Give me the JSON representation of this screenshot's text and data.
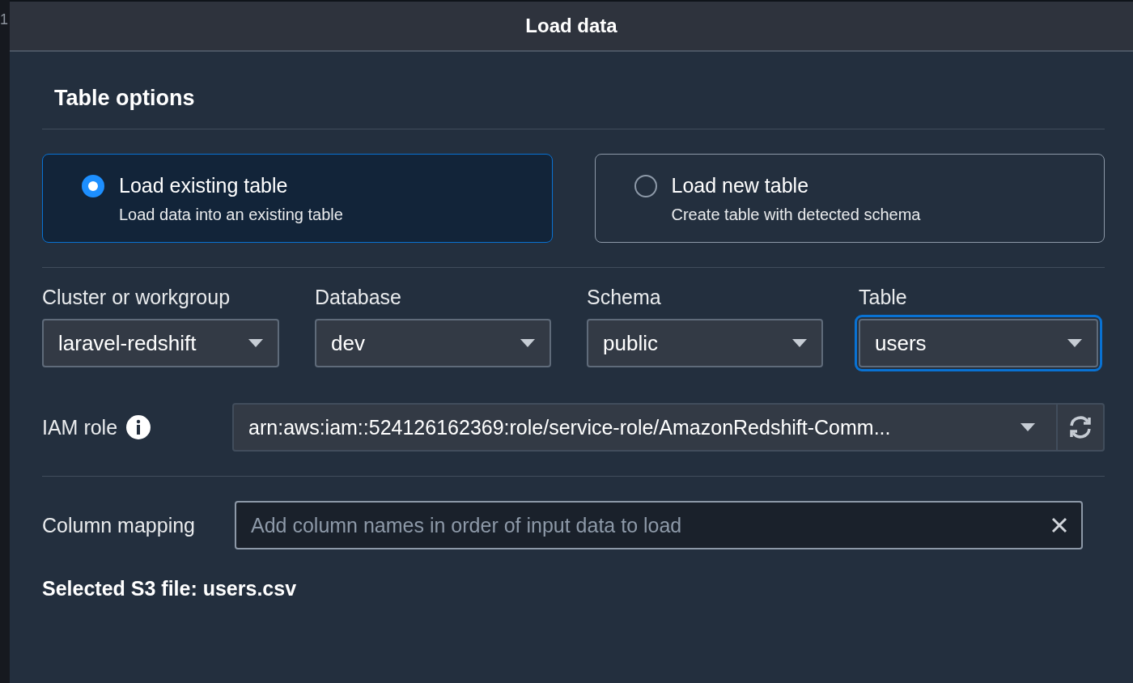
{
  "gutter": {
    "line_number": "1"
  },
  "dialog": {
    "title": "Load data"
  },
  "section": {
    "title": "Table options"
  },
  "load_options": [
    {
      "label": "Load existing table",
      "description": "Load data into an existing table",
      "selected": true
    },
    {
      "label": "Load new table",
      "description": "Create table with detected schema",
      "selected": false
    }
  ],
  "selects": [
    {
      "label": "Cluster or workgroup",
      "value": "laravel-redshift",
      "focused": false
    },
    {
      "label": "Database",
      "value": "dev",
      "focused": false
    },
    {
      "label": "Schema",
      "value": "public",
      "focused": false
    },
    {
      "label": "Table",
      "value": "users",
      "focused": true
    }
  ],
  "iam_role": {
    "label": "IAM role",
    "value": "arn:aws:iam::524126162369:role/service-role/AmazonRedshift-Comm..."
  },
  "column_mapping": {
    "label": "Column mapping",
    "placeholder": "Add column names in order of input data to load"
  },
  "selected_file": "Selected S3 file: users.csv"
}
